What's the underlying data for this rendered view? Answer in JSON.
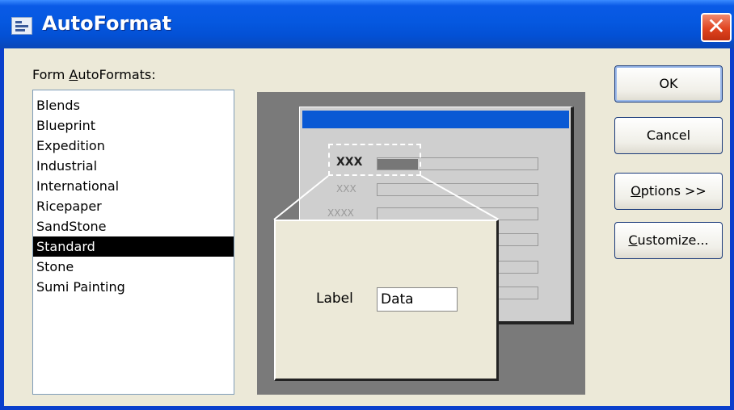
{
  "window": {
    "title": "AutoFormat",
    "close_label": "✕"
  },
  "list": {
    "label": "Form AutoFormats:",
    "items": [
      "Blends",
      "Blueprint",
      "Expedition",
      "Industrial",
      "International",
      "Ricepaper",
      "SandStone",
      "Standard",
      "Stone",
      "Sumi Painting"
    ],
    "selected": "Standard"
  },
  "preview": {
    "field_labels": [
      "XXX",
      "XXX",
      "XXXX"
    ],
    "zoom_label": "Label",
    "zoom_data": "Data"
  },
  "buttons": {
    "ok": "OK",
    "cancel": "Cancel",
    "options": "Options >>",
    "customize": "Customize..."
  },
  "colors": {
    "title_bar": "#0558e0",
    "selection": "#000000",
    "preview_header": "#0a59d4"
  }
}
